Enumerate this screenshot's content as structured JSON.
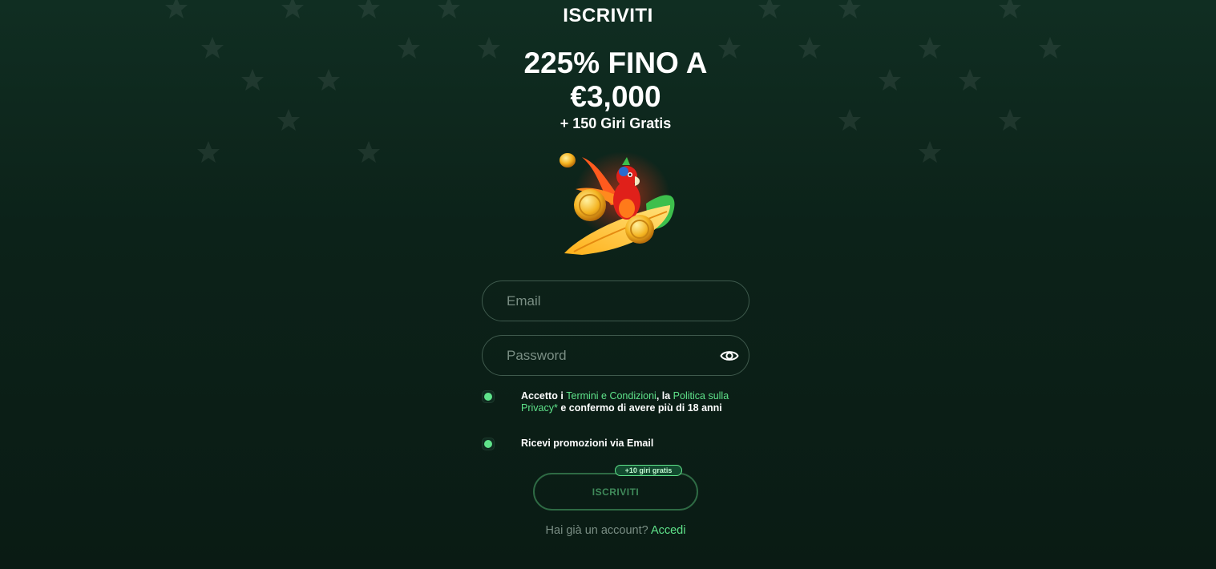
{
  "header": {
    "title": "ISCRIVITI"
  },
  "promo": {
    "headline_line1": "225% FINO A",
    "headline_line2": "€3,000",
    "subline": "+ 150 Giri Gratis"
  },
  "form": {
    "email_placeholder": "Email",
    "password_placeholder": "Password",
    "password_icon": "eye-icon",
    "terms": {
      "checked": true,
      "prefix": "Accetto i ",
      "terms_link": "Termini e Condizioni",
      "middle": ", la ",
      "privacy_link": "Politica sulla Privacy*",
      "suffix": " e confermo di avere più di 18 anni"
    },
    "promotions": {
      "checked": true,
      "label": "Ricevi promozioni via Email"
    },
    "submit_badge": "+10 giri gratis",
    "submit_label": "ISCRIVITI"
  },
  "footer": {
    "question": "Hai già un account? ",
    "login_link": "Accedi"
  },
  "colors": {
    "accent_green": "#5fe38a",
    "background": "#0c2219",
    "muted_text": "#7a8e84"
  }
}
